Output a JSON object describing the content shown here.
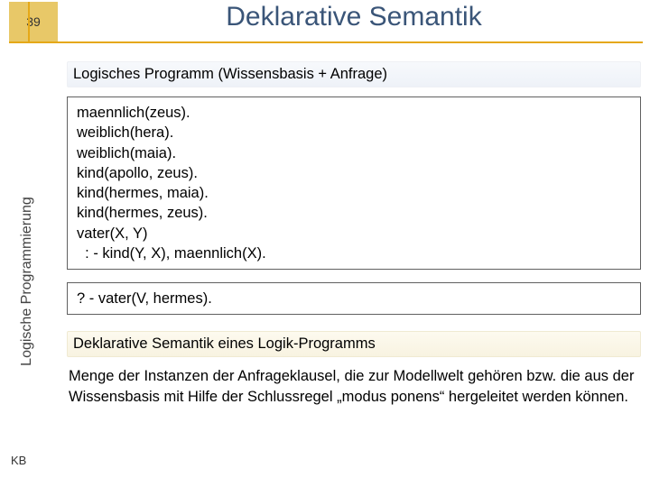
{
  "page_number": "39",
  "title": "Deklarative Semantik",
  "sidebar": "Logische Programmierung",
  "footer_left": "KB",
  "heading1": "Logisches Programm (Wissensbasis + Anfrage)",
  "code_block1": "maennlich(zeus).\nweiblich(hera).\nweiblich(maia).\nkind(apollo, zeus).\nkind(hermes, maia).\nkind(hermes, zeus).\nvater(X, Y)\n  : - kind(Y, X), maennlich(X).",
  "code_block2": "? - vater(V, hermes).",
  "heading2": "Deklarative Semantik eines Logik-Programms",
  "explanation": "Menge der Instanzen der Anfrageklausel, die zur Modellwelt gehören bzw. die aus der Wissensbasis mit Hilfe der Schlussregel „modus ponens“ hergeleitet werden können."
}
